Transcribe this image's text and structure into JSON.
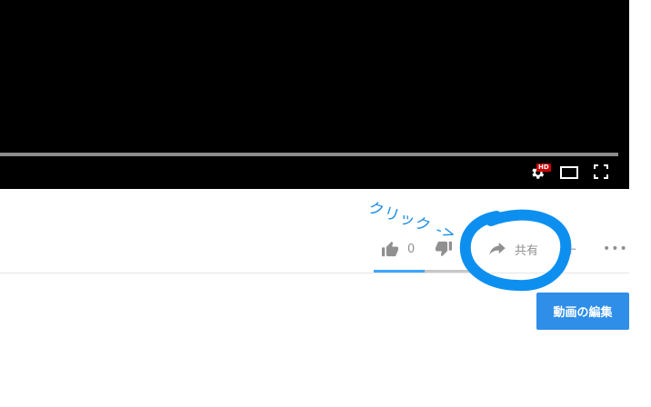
{
  "player": {
    "hd_badge": "HD",
    "progress_fraction": 1.0,
    "icons": [
      "settings-icon",
      "theater-mode-icon",
      "fullscreen-icon"
    ]
  },
  "actions": {
    "like_count": "0",
    "share_label": "共有",
    "add_symbol": "+",
    "more_symbol": "•••",
    "icons": [
      "thumbs-up-icon",
      "thumbs-down-icon",
      "share-arrow-icon"
    ]
  },
  "edit_button": {
    "label": "動画の編集"
  },
  "annotation": {
    "text": "クリック ->",
    "color": "#1e8fe5"
  },
  "colors": {
    "accent_blue": "#2e8ee8",
    "like_bar": "#3ea6ff",
    "hd_red": "#cc0000",
    "player_bg": "#000000"
  }
}
